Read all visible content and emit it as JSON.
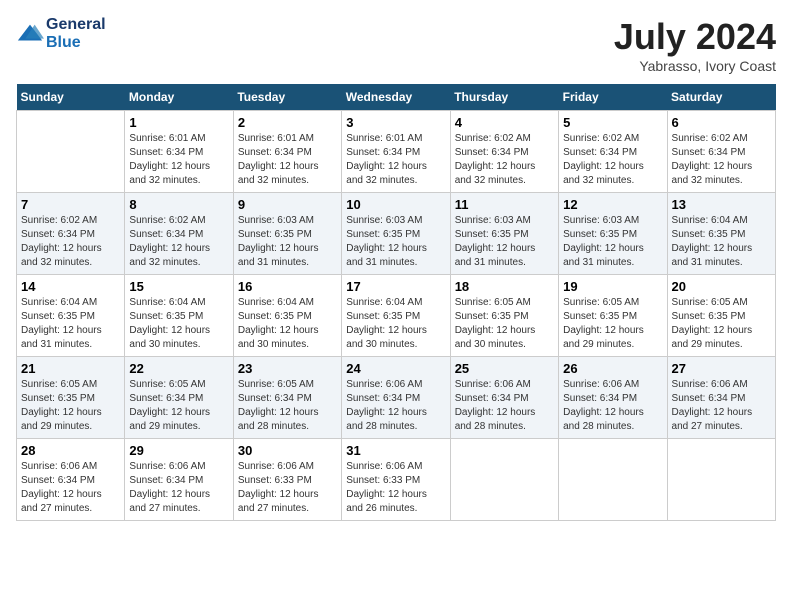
{
  "header": {
    "logo_line1": "General",
    "logo_line2": "Blue",
    "month_year": "July 2024",
    "location": "Yabrasso, Ivory Coast"
  },
  "days_of_week": [
    "Sunday",
    "Monday",
    "Tuesday",
    "Wednesday",
    "Thursday",
    "Friday",
    "Saturday"
  ],
  "weeks": [
    [
      {
        "num": "",
        "empty": true
      },
      {
        "num": "1",
        "sunrise": "6:01 AM",
        "sunset": "6:34 PM",
        "daylight": "12 hours and 32 minutes."
      },
      {
        "num": "2",
        "sunrise": "6:01 AM",
        "sunset": "6:34 PM",
        "daylight": "12 hours and 32 minutes."
      },
      {
        "num": "3",
        "sunrise": "6:01 AM",
        "sunset": "6:34 PM",
        "daylight": "12 hours and 32 minutes."
      },
      {
        "num": "4",
        "sunrise": "6:02 AM",
        "sunset": "6:34 PM",
        "daylight": "12 hours and 32 minutes."
      },
      {
        "num": "5",
        "sunrise": "6:02 AM",
        "sunset": "6:34 PM",
        "daylight": "12 hours and 32 minutes."
      },
      {
        "num": "6",
        "sunrise": "6:02 AM",
        "sunset": "6:34 PM",
        "daylight": "12 hours and 32 minutes."
      }
    ],
    [
      {
        "num": "7",
        "sunrise": "6:02 AM",
        "sunset": "6:34 PM",
        "daylight": "12 hours and 32 minutes."
      },
      {
        "num": "8",
        "sunrise": "6:02 AM",
        "sunset": "6:34 PM",
        "daylight": "12 hours and 32 minutes."
      },
      {
        "num": "9",
        "sunrise": "6:03 AM",
        "sunset": "6:35 PM",
        "daylight": "12 hours and 31 minutes."
      },
      {
        "num": "10",
        "sunrise": "6:03 AM",
        "sunset": "6:35 PM",
        "daylight": "12 hours and 31 minutes."
      },
      {
        "num": "11",
        "sunrise": "6:03 AM",
        "sunset": "6:35 PM",
        "daylight": "12 hours and 31 minutes."
      },
      {
        "num": "12",
        "sunrise": "6:03 AM",
        "sunset": "6:35 PM",
        "daylight": "12 hours and 31 minutes."
      },
      {
        "num": "13",
        "sunrise": "6:04 AM",
        "sunset": "6:35 PM",
        "daylight": "12 hours and 31 minutes."
      }
    ],
    [
      {
        "num": "14",
        "sunrise": "6:04 AM",
        "sunset": "6:35 PM",
        "daylight": "12 hours and 31 minutes."
      },
      {
        "num": "15",
        "sunrise": "6:04 AM",
        "sunset": "6:35 PM",
        "daylight": "12 hours and 30 minutes."
      },
      {
        "num": "16",
        "sunrise": "6:04 AM",
        "sunset": "6:35 PM",
        "daylight": "12 hours and 30 minutes."
      },
      {
        "num": "17",
        "sunrise": "6:04 AM",
        "sunset": "6:35 PM",
        "daylight": "12 hours and 30 minutes."
      },
      {
        "num": "18",
        "sunrise": "6:05 AM",
        "sunset": "6:35 PM",
        "daylight": "12 hours and 30 minutes."
      },
      {
        "num": "19",
        "sunrise": "6:05 AM",
        "sunset": "6:35 PM",
        "daylight": "12 hours and 29 minutes."
      },
      {
        "num": "20",
        "sunrise": "6:05 AM",
        "sunset": "6:35 PM",
        "daylight": "12 hours and 29 minutes."
      }
    ],
    [
      {
        "num": "21",
        "sunrise": "6:05 AM",
        "sunset": "6:35 PM",
        "daylight": "12 hours and 29 minutes."
      },
      {
        "num": "22",
        "sunrise": "6:05 AM",
        "sunset": "6:34 PM",
        "daylight": "12 hours and 29 minutes."
      },
      {
        "num": "23",
        "sunrise": "6:05 AM",
        "sunset": "6:34 PM",
        "daylight": "12 hours and 28 minutes."
      },
      {
        "num": "24",
        "sunrise": "6:06 AM",
        "sunset": "6:34 PM",
        "daylight": "12 hours and 28 minutes."
      },
      {
        "num": "25",
        "sunrise": "6:06 AM",
        "sunset": "6:34 PM",
        "daylight": "12 hours and 28 minutes."
      },
      {
        "num": "26",
        "sunrise": "6:06 AM",
        "sunset": "6:34 PM",
        "daylight": "12 hours and 28 minutes."
      },
      {
        "num": "27",
        "sunrise": "6:06 AM",
        "sunset": "6:34 PM",
        "daylight": "12 hours and 27 minutes."
      }
    ],
    [
      {
        "num": "28",
        "sunrise": "6:06 AM",
        "sunset": "6:34 PM",
        "daylight": "12 hours and 27 minutes."
      },
      {
        "num": "29",
        "sunrise": "6:06 AM",
        "sunset": "6:34 PM",
        "daylight": "12 hours and 27 minutes."
      },
      {
        "num": "30",
        "sunrise": "6:06 AM",
        "sunset": "6:33 PM",
        "daylight": "12 hours and 27 minutes."
      },
      {
        "num": "31",
        "sunrise": "6:06 AM",
        "sunset": "6:33 PM",
        "daylight": "12 hours and 26 minutes."
      },
      {
        "num": "",
        "empty": true
      },
      {
        "num": "",
        "empty": true
      },
      {
        "num": "",
        "empty": true
      }
    ]
  ],
  "labels": {
    "sunrise_prefix": "Sunrise: ",
    "sunset_prefix": "Sunset: ",
    "daylight_prefix": "Daylight: "
  }
}
